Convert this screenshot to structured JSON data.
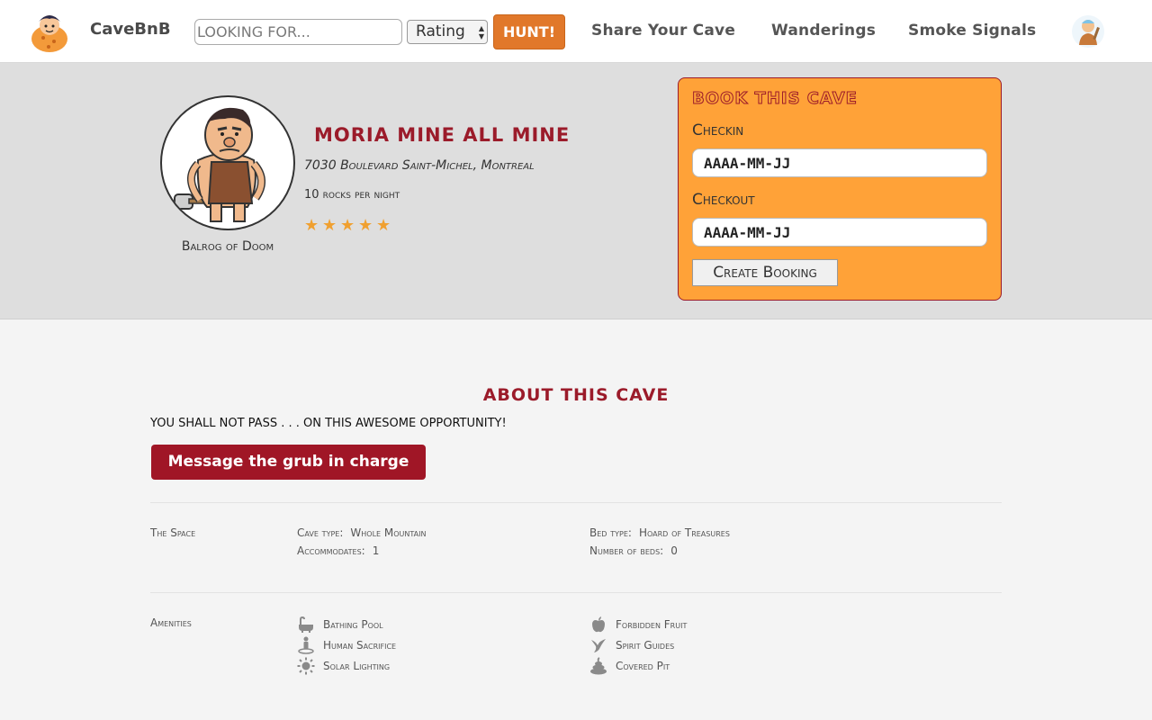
{
  "nav": {
    "brand": "CaveBnB",
    "search_placeholder": "LOOKING FOR...",
    "sort_selected": "Rating",
    "hunt_label": "HUNT!",
    "links": [
      "Share Your Cave",
      "Wanderings",
      "Smoke Signals"
    ]
  },
  "host": {
    "name": "Balrog of Doom"
  },
  "listing": {
    "title": "Moria Mine All Mine",
    "address": "7030 Boulevard Saint-Michel, Montreal",
    "price": "10 rocks per night",
    "rating": 5
  },
  "booking": {
    "title": "Book This Cave",
    "checkin_label": "Checkin",
    "checkin_placeholder": "AAAA-MM-JJ",
    "checkout_label": "Checkout",
    "checkout_placeholder": "AAAA-MM-JJ",
    "submit_label": "Create Booking"
  },
  "about": {
    "title": "About This Cave",
    "description": "YOU SHALL NOT PASS . . . ON THIS AWESOME OPPORTUNITY!",
    "message_button": "Message the grub in charge"
  },
  "space": {
    "label": "The Space",
    "cave_type_key": "Cave type:",
    "cave_type": "Whole Mountain",
    "accommodates_key": "Accommodates:",
    "accommodates": "1",
    "bed_type_key": "Bed type:",
    "bed_type": "Hoard of Treasures",
    "beds_key": "Number of beds:",
    "beds": "0"
  },
  "amenities": {
    "label": "Amenities",
    "items": [
      {
        "label": "Bathing Pool",
        "icon": "bath-icon"
      },
      {
        "label": "Human Sacrifice",
        "icon": "person-pin-icon"
      },
      {
        "label": "Solar Lighting",
        "icon": "sun-icon"
      },
      {
        "label": "Forbidden Fruit",
        "icon": "apple-icon"
      },
      {
        "label": "Spirit Guides",
        "icon": "bird-icon"
      },
      {
        "label": "Covered Pit",
        "icon": "poop-icon"
      }
    ]
  },
  "colors": {
    "accent": "#9b1b2a",
    "orange": "#ffa238",
    "hunt": "#e1782a"
  }
}
